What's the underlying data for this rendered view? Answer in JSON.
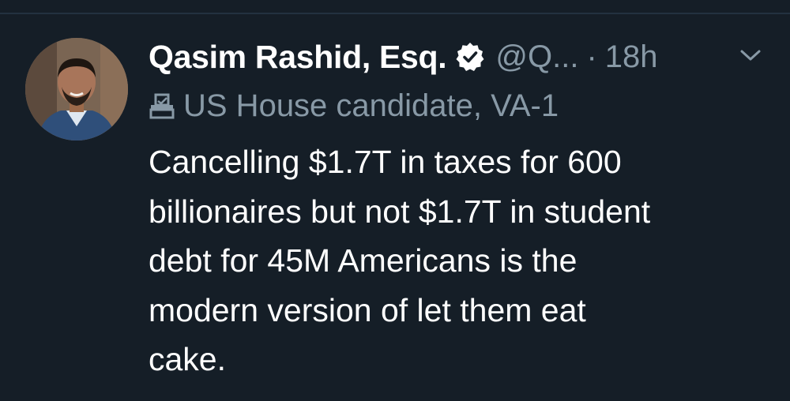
{
  "tweet": {
    "display_name": "Qasim Rashid, Esq.",
    "handle": "@Q...",
    "separator": "·",
    "timestamp": "18h",
    "bio": "US House candidate, VA-1",
    "body_lines": [
      "Cancelling $1.7T in taxes for 600",
      "billionaires but not $1.7T in student",
      "debt for 45M Americans is the",
      "modern version of let them eat",
      "cake."
    ]
  },
  "icons": {
    "verified": "verified-badge-icon",
    "menu": "chevron-down-icon",
    "bio": "ballot-box-icon"
  },
  "colors": {
    "background": "#151e27",
    "primary_text": "#ffffff",
    "secondary_text": "#8899a6"
  }
}
